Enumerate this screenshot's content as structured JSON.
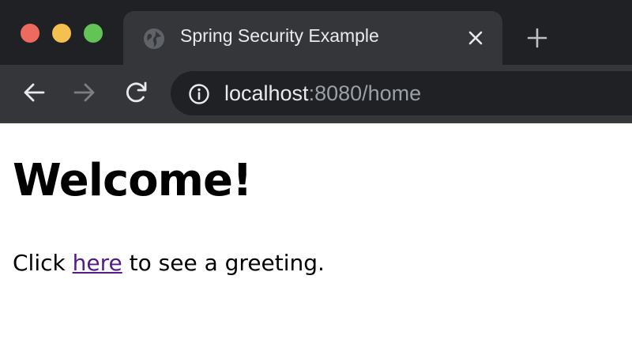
{
  "browser": {
    "tab": {
      "title": "Spring Security Example",
      "favicon": "globe-icon",
      "close_icon": "close-icon"
    },
    "new_tab_icon": "plus-icon",
    "nav": {
      "back_icon": "arrow-left-icon",
      "forward_icon": "arrow-right-icon",
      "reload_icon": "reload-icon"
    },
    "address": {
      "info_icon": "info-icon",
      "host": "localhost",
      "rest": ":8080/home"
    },
    "colors": {
      "tab_strip": "#202124",
      "toolbar": "#35363a",
      "traffic_red": "#ed6a5e",
      "traffic_yellow": "#f4c04f",
      "traffic_green": "#61c454"
    }
  },
  "page": {
    "heading": "Welcome!",
    "paragraph": {
      "before": "Click ",
      "link": "here",
      "after": " to see a greeting."
    },
    "link_color": "#551a8b"
  }
}
